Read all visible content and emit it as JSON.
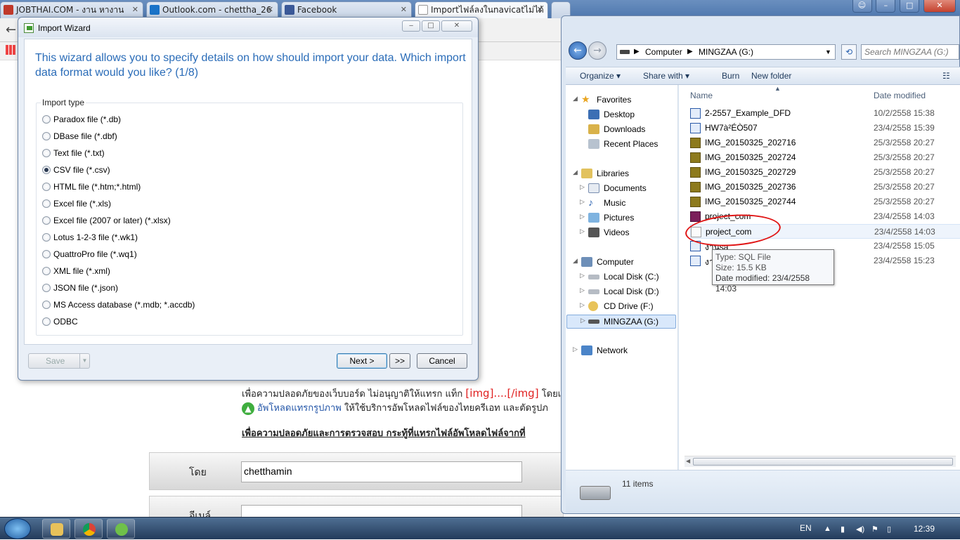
{
  "browser": {
    "tabs": [
      {
        "label": "JOBTHAI.COM - งาน หางาน",
        "fav_color": "#c0392b"
      },
      {
        "label": "Outlook.com - chettha_26",
        "fav_color": "#1a73c8"
      },
      {
        "label": "Facebook",
        "fav_color": "#3b5998"
      },
      {
        "label": "Importไฟล์ลงในnavicatไม่ได้",
        "fav_color": "#ffffff"
      }
    ],
    "window_controls": {
      "minimize": "–",
      "maximize": "□",
      "close": "✕"
    }
  },
  "forum": {
    "line1_prefix": "เพื่อความปลอดภัยของเว็บบอร์ด ไม่อนุญาติให้แทรก แท็ก ",
    "line1_tag": "[img]....[/img]",
    "line1_suffix": " โดยเ",
    "line2_link": "อัพโหลดแทรกรูปภาพ",
    "line2_suffix": " ให้ใช้บริการอัพโหลดไฟล์ของไทยครีเอท และตัดรูปภ",
    "line3": "เพื่อความปลอดภัยและการตรวจสอบ กระทู้ที่แทรกไฟล์อัพโหลดไฟล์จากที่",
    "author_label": "โดย",
    "author_value": "chetthamin",
    "email_label": "อีเมล์"
  },
  "wizard": {
    "title": "Import Wizard",
    "heading": "This wizard allows you to specify details on how should import your data. Which import data format would you like? (1/8)",
    "group_label": "Import type",
    "options": [
      {
        "label": "Paradox file (*.db)",
        "checked": false
      },
      {
        "label": "DBase file (*.dbf)",
        "checked": false
      },
      {
        "label": "Text file (*.txt)",
        "checked": false
      },
      {
        "label": "CSV file (*.csv)",
        "checked": true
      },
      {
        "label": "HTML file (*.htm;*.html)",
        "checked": false
      },
      {
        "label": "Excel file (*.xls)",
        "checked": false
      },
      {
        "label": "Excel file (2007 or later) (*.xlsx)",
        "checked": false
      },
      {
        "label": "Lotus 1-2-3 file (*.wk1)",
        "checked": false
      },
      {
        "label": "QuattroPro file (*.wq1)",
        "checked": false
      },
      {
        "label": "XML file (*.xml)",
        "checked": false
      },
      {
        "label": "JSON file (*.json)",
        "checked": false
      },
      {
        "label": "MS Access database (*.mdb; *.accdb)",
        "checked": false
      },
      {
        "label": "ODBC",
        "checked": false
      }
    ],
    "buttons": {
      "save": "Save",
      "next": "Next >",
      "skip": ">>",
      "cancel": "Cancel"
    }
  },
  "explorer": {
    "address": {
      "computer": "Computer",
      "drive": "MINGZAA (G:)"
    },
    "search_placeholder": "Search MINGZAA (G:)",
    "commands": {
      "organize": "Organize ▾",
      "share": "Share with ▾",
      "burn": "Burn",
      "new_folder": "New folder"
    },
    "nav": {
      "favorites": "Favorites",
      "desktop": "Desktop",
      "downloads": "Downloads",
      "recent": "Recent Places",
      "libraries": "Libraries",
      "documents": "Documents",
      "music": "Music",
      "pictures": "Pictures",
      "videos": "Videos",
      "computer": "Computer",
      "drive_c": "Local Disk (C:)",
      "drive_d": "Local Disk (D:)",
      "drive_f": "CD Drive (F:)",
      "drive_g": "MINGZAA (G:)",
      "network": "Network"
    },
    "columns": {
      "name": "Name",
      "date": "Date modified"
    },
    "files": [
      {
        "name": "2-2557_Example_DFD",
        "date": "10/2/2558 15:38",
        "kind": "doc"
      },
      {
        "name": "HW7à²ÉÒ507",
        "date": "23/4/2558 15:39",
        "kind": "doc"
      },
      {
        "name": "IMG_20150325_202716",
        "date": "25/3/2558 20:27",
        "kind": "img"
      },
      {
        "name": "IMG_20150325_202724",
        "date": "25/3/2558 20:27",
        "kind": "img"
      },
      {
        "name": "IMG_20150325_202729",
        "date": "25/3/2558 20:27",
        "kind": "img"
      },
      {
        "name": "IMG_20150325_202736",
        "date": "25/3/2558 20:27",
        "kind": "img"
      },
      {
        "name": "IMG_20150325_202744",
        "date": "25/3/2558 20:27",
        "kind": "img"
      },
      {
        "name": "project_com",
        "date": "23/4/2558 14:03",
        "kind": "rar"
      },
      {
        "name": "project_com",
        "date": "23/4/2558 14:03",
        "kind": "sql"
      },
      {
        "name": "งานsa",
        "date": "23/4/2558 15:05",
        "kind": "doc"
      },
      {
        "name": "งา",
        "date": "23/4/2558 15:23",
        "kind": "doc"
      }
    ],
    "tooltip": {
      "type": "Type: SQL File",
      "size": "Size: 15.5 KB",
      "modified": "Date modified: 23/4/2558 14:03"
    },
    "item_count": "11 items"
  },
  "taskbar": {
    "lang": "EN",
    "time": "12:39"
  }
}
